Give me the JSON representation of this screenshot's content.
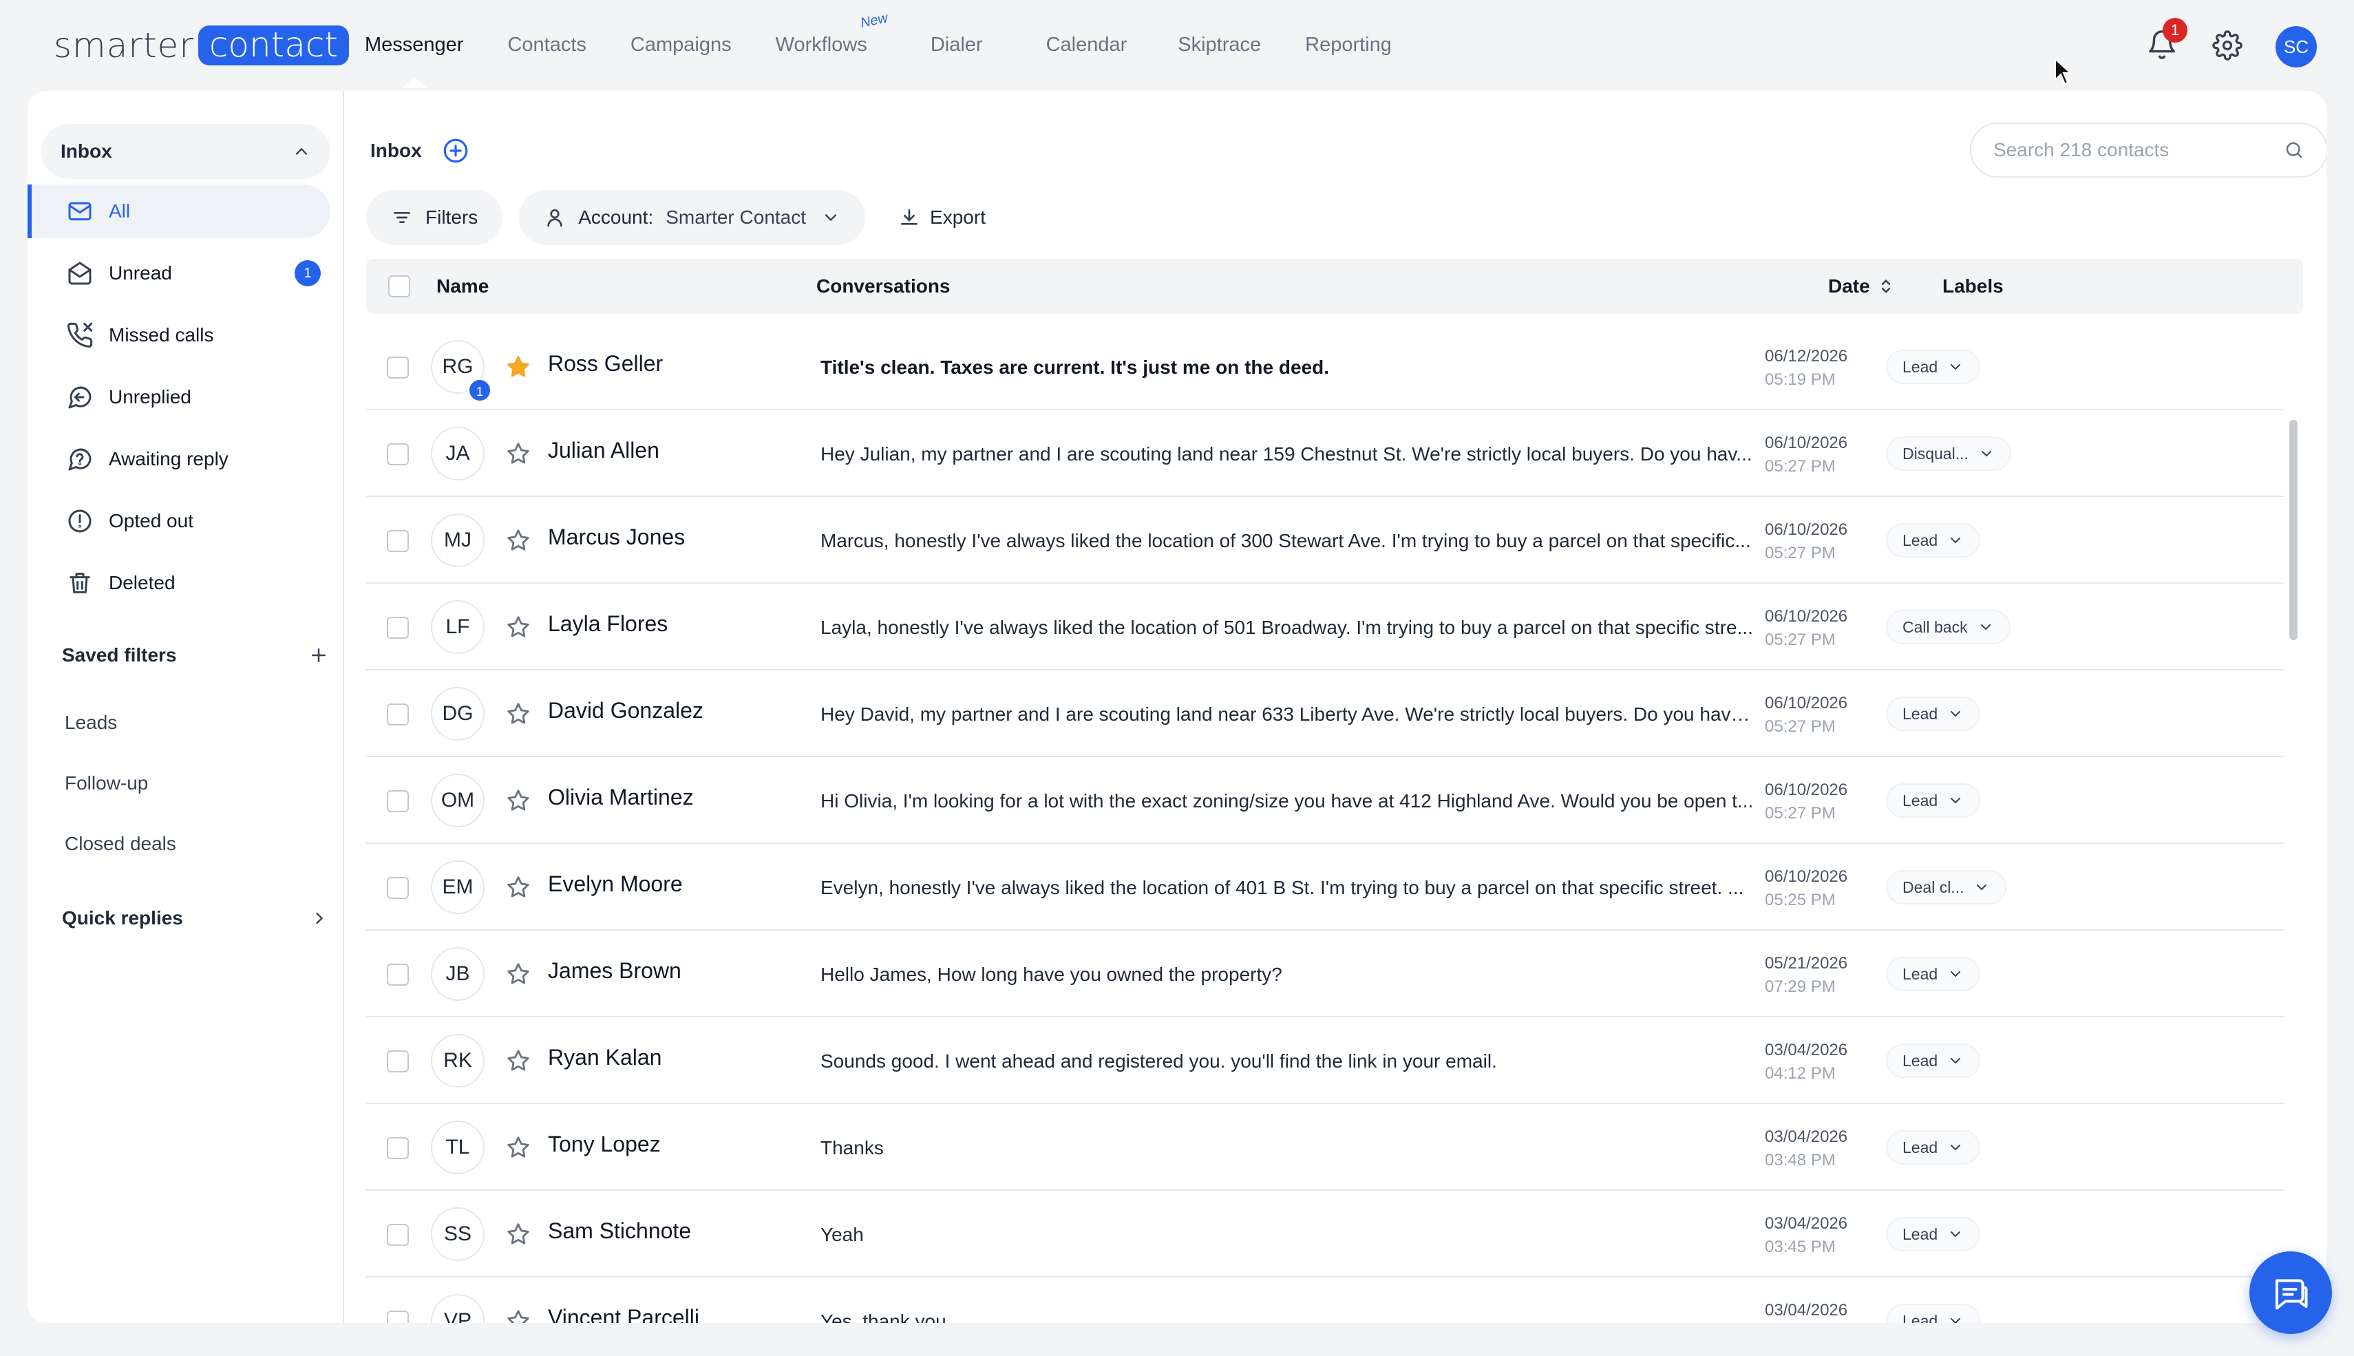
{
  "brand": {
    "part1": "smarter",
    "part2": "contact",
    "accent": "#2563eb"
  },
  "nav": {
    "items": [
      "Messenger",
      "Contacts",
      "Campaigns",
      "Workflows",
      "Dialer",
      "Calendar",
      "Skiptrace",
      "Reporting"
    ],
    "active": "Messenger",
    "new_tag": "New"
  },
  "topbar": {
    "notification_count": "1",
    "user_initials": "SC"
  },
  "sidebar": {
    "header": "Inbox",
    "items": [
      {
        "label": "All",
        "icon": "mail-icon"
      },
      {
        "label": "Unread",
        "icon": "mail-open-icon",
        "badge": "1"
      },
      {
        "label": "Missed calls",
        "icon": "phone-missed-icon"
      },
      {
        "label": "Unreplied",
        "icon": "reply-icon"
      },
      {
        "label": "Awaiting reply",
        "icon": "help-circle-icon"
      },
      {
        "label": "Opted out",
        "icon": "alert-circle-icon"
      },
      {
        "label": "Deleted",
        "icon": "trash-icon"
      }
    ],
    "saved_filters_title": "Saved filters",
    "saved_filters": [
      "Leads",
      "Follow-up",
      "Closed deals"
    ],
    "quick_replies": "Quick replies"
  },
  "content": {
    "title": "Inbox",
    "search_placeholder": "Search 218 contacts",
    "filters_label": "Filters",
    "account_label": "Account:",
    "account_value": "Smarter Contact",
    "export_label": "Export"
  },
  "table": {
    "columns": {
      "name": "Name",
      "conversations": "Conversations",
      "date": "Date",
      "labels": "Labels"
    },
    "rows": [
      {
        "initials": "RG",
        "badge": "1",
        "starred": true,
        "name": "Ross Geller",
        "conversation": "Title's clean. Taxes are current. It's just me on the deed.",
        "date": "06/12/2026",
        "time": "05:19 PM",
        "label": "Lead",
        "unread": true
      },
      {
        "initials": "JA",
        "starred": false,
        "name": "Julian Allen",
        "conversation": "Hey Julian, my partner and I are scouting land near 159 Chestnut St. We're strictly local buyers. Do you hav...",
        "date": "06/10/2026",
        "time": "05:27 PM",
        "label": "Disqual..."
      },
      {
        "initials": "MJ",
        "starred": false,
        "name": "Marcus Jones",
        "conversation": "Marcus, honestly I've always liked the location of 300 Stewart Ave. I'm trying to buy a parcel on that specific...",
        "date": "06/10/2026",
        "time": "05:27 PM",
        "label": "Lead"
      },
      {
        "initials": "LF",
        "starred": false,
        "name": "Layla Flores",
        "conversation": "Layla, honestly I've always liked the location of 501 Broadway. I'm trying to buy a parcel on that specific stre...",
        "date": "06/10/2026",
        "time": "05:27 PM",
        "label": "Call back"
      },
      {
        "initials": "DG",
        "starred": false,
        "name": "David Gonzalez",
        "conversation": "Hey David, my partner and I are scouting land near 633 Liberty Ave. We're strictly local buyers. Do you have ...",
        "date": "06/10/2026",
        "time": "05:27 PM",
        "label": "Lead"
      },
      {
        "initials": "OM",
        "starred": false,
        "name": "Olivia Martinez",
        "conversation": "Hi Olivia, I'm looking for a lot with the exact zoning/size you have at 412 Highland Ave. Would you be open t...",
        "date": "06/10/2026",
        "time": "05:27 PM",
        "label": "Lead"
      },
      {
        "initials": "EM",
        "starred": false,
        "name": "Evelyn Moore",
        "conversation": "Evelyn, honestly I've always liked the location of 401 B St. I'm trying to buy a parcel on that specific street. ...",
        "date": "06/10/2026",
        "time": "05:25 PM",
        "label": "Deal cl..."
      },
      {
        "initials": "JB",
        "starred": false,
        "name": "James Brown",
        "conversation": "Hello James, How long have you owned the property?",
        "date": "05/21/2026",
        "time": "07:29 PM",
        "label": "Lead"
      },
      {
        "initials": "RK",
        "starred": false,
        "name": "Ryan Kalan",
        "conversation": "Sounds good. I went ahead and registered you. you'll find the link in your email.",
        "date": "03/04/2026",
        "time": "04:12 PM",
        "label": "Lead"
      },
      {
        "initials": "TL",
        "starred": false,
        "name": "Tony Lopez",
        "conversation": "Thanks",
        "date": "03/04/2026",
        "time": "03:48 PM",
        "label": "Lead"
      },
      {
        "initials": "SS",
        "starred": false,
        "name": "Sam Stichnote",
        "conversation": "Yeah",
        "date": "03/04/2026",
        "time": "03:45 PM",
        "label": "Lead"
      },
      {
        "initials": "VP",
        "starred": false,
        "name": "Vincent Parcelli",
        "conversation": "Yes, thank you",
        "date": "03/04/2026",
        "time": "",
        "label": "Lead"
      }
    ]
  }
}
